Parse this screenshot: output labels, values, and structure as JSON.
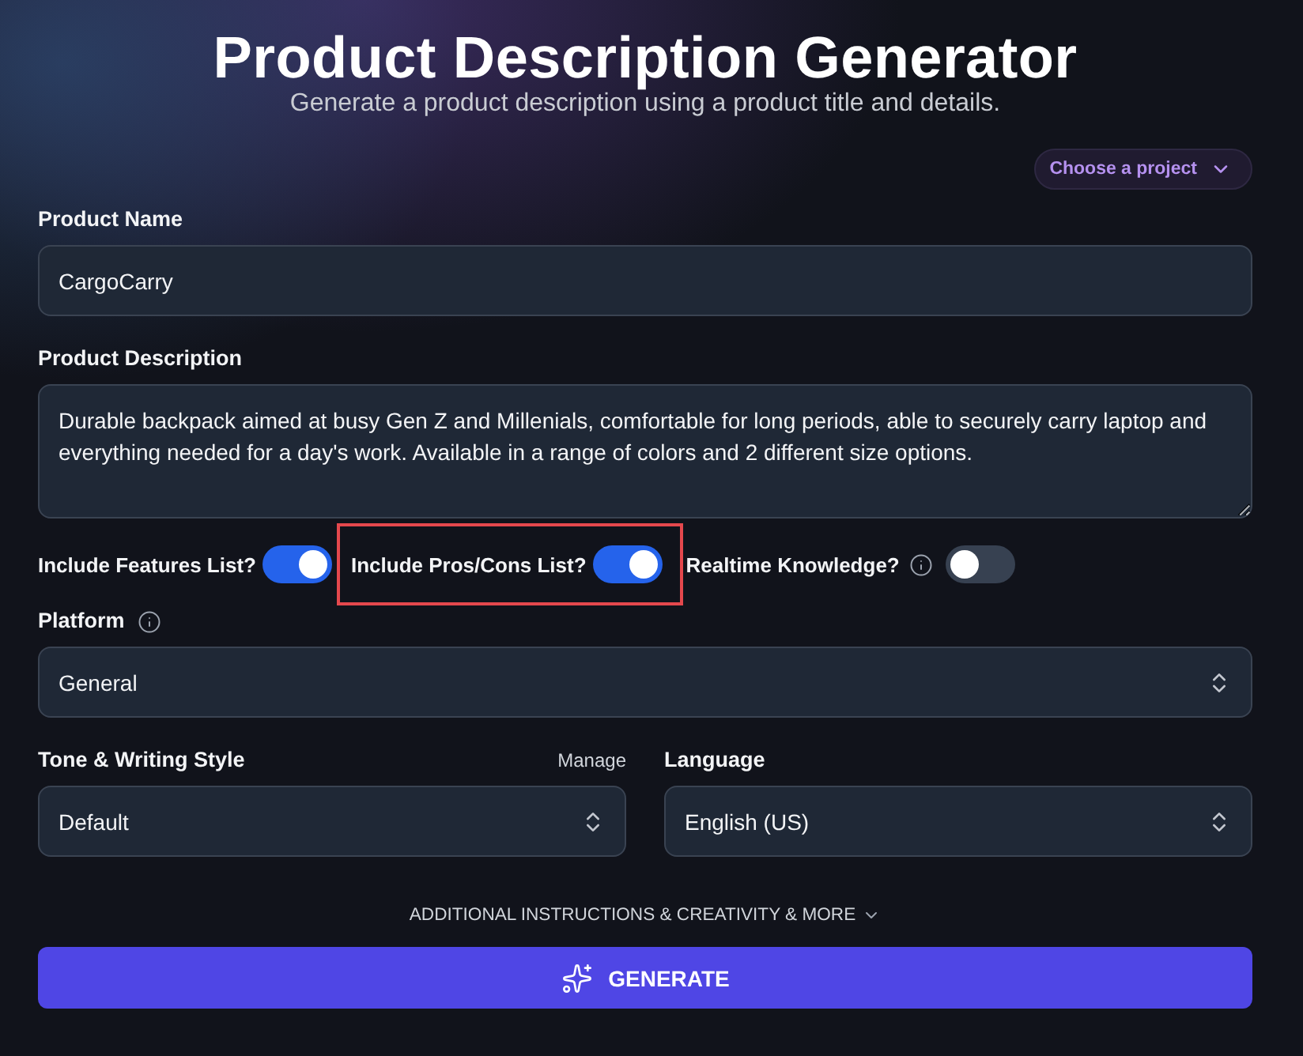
{
  "header": {
    "title": "Product Description Generator",
    "subtitle": "Generate a product description using a product title and details."
  },
  "project_picker": {
    "label": "Choose a project"
  },
  "product_name": {
    "label": "Product Name",
    "value": "CargoCarry"
  },
  "product_description": {
    "label": "Product Description",
    "value": "Durable backpack aimed at busy Gen Z and Millenials, comfortable for long periods, able to securely carry laptop and everything needed for a day's work. Available in a range of colors and 2 different size options."
  },
  "toggles": [
    {
      "label": "Include Features List?",
      "on": true,
      "info": false,
      "highlighted": false
    },
    {
      "label": "Include Pros/Cons List?",
      "on": true,
      "info": false,
      "highlighted": true
    },
    {
      "label": "Realtime Knowledge?",
      "on": false,
      "info": true,
      "highlighted": false
    }
  ],
  "platform": {
    "label": "Platform",
    "info": true,
    "value": "General"
  },
  "tone": {
    "label": "Tone & Writing Style",
    "action": "Manage",
    "value": "Default"
  },
  "language": {
    "label": "Language",
    "value": "English (US)"
  },
  "more_options": {
    "label": "ADDITIONAL INSTRUCTIONS & CREATIVITY & MORE",
    "expanded": false
  },
  "generate_button": {
    "label": "GENERATE"
  }
}
